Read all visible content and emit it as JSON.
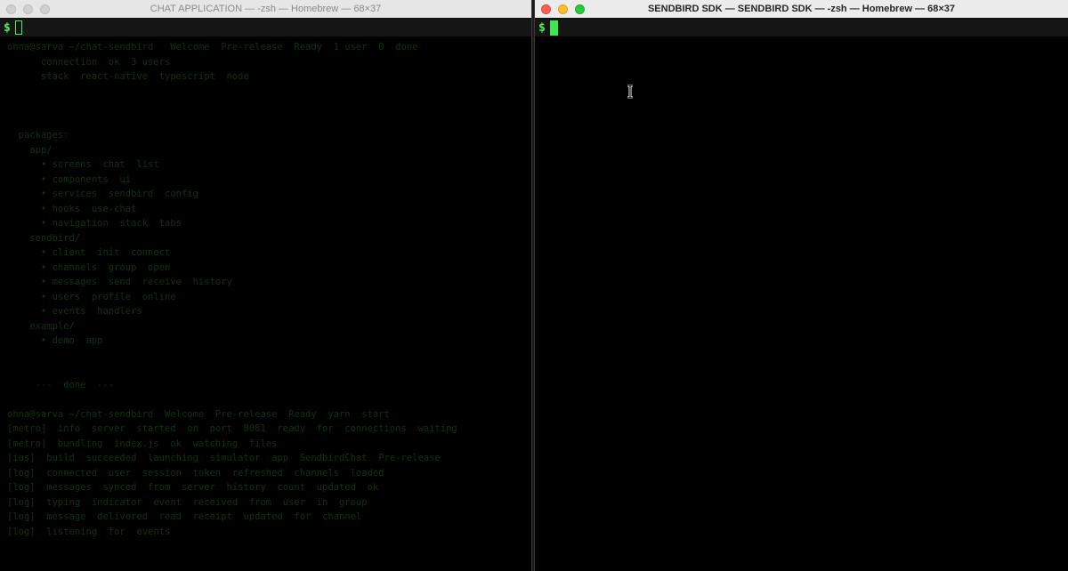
{
  "windows": {
    "left": {
      "title": "CHAT APPLICATION — -zsh — Homebrew — 68×37",
      "prompt": "$",
      "cursor_style": "hollow-block",
      "residual_lines": [
        "ohna@sarva ~/chat-sendbird   Welcome  Pre-release  Ready  1 user  0  done",
        "      connection  ok  3 users",
        "      stack  react-native  typescript  node",
        "",
        "",
        "",
        "  packages:",
        "    app/",
        "      • screens  chat  list",
        "      • components  ui",
        "      • services  sendbird  config",
        "      • hooks  use-chat",
        "      • navigation  stack  tabs",
        "    sendbird/",
        "      • client  init  connect",
        "      • channels  group  open",
        "      • messages  send  receive  history",
        "      • users  profile  online",
        "      • events  handlers",
        "    example/",
        "      • demo  app",
        "",
        "",
        "     ---  done  ---",
        "",
        "ohna@sarva ~/chat-sendbird  Welcome  Pre-release  Ready  yarn  start",
        "[metro]  info  server  started  on  port  8081  ready  for  connections  waiting",
        "[metro]  bundling  index.js  ok  watching  files",
        "[ios]  build  succeeded  launching  simulator  app  SendbirdChat  Pre-release",
        "[log]  connected  user  session  token  refreshed  channels  loaded",
        "[log]  messages  synced  from  server  history  count  updated  ok",
        "[log]  typing  indicator  event  received  from  user  in  group",
        "[log]  message  delivered  read  receipt  updated  for  channel",
        "[log]  listening  for  events"
      ]
    },
    "right": {
      "title": "SENDBIRD SDK — SENDBIRD SDK — -zsh — Homebrew — 68×37",
      "prompt": "$",
      "cursor_style": "solid-block"
    }
  },
  "colors": {
    "terminal_background": "#000000",
    "prompt_green": "#4af05a",
    "residual_text": "#1f5a25",
    "close": "#ff5f57",
    "minimize": "#febc2e",
    "maximize": "#28c840"
  }
}
